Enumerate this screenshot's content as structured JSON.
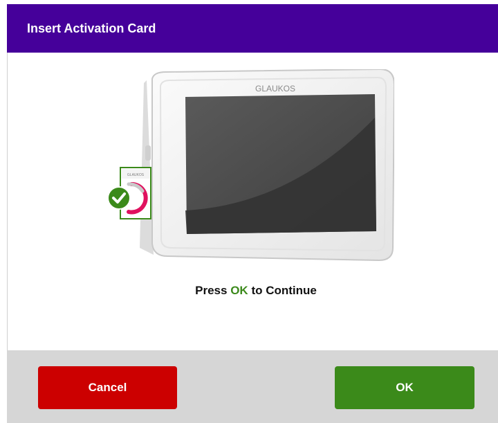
{
  "dialog": {
    "title": "Insert Activation Card",
    "message": {
      "prefix": "Press",
      "highlight": "OK",
      "suffix": "to Continue"
    }
  },
  "device": {
    "brand": "GLAUKOS",
    "card_brand": "GLAUKOS"
  },
  "buttons": {
    "cancel_label": "Cancel",
    "ok_label": "OK"
  },
  "colors": {
    "title_bar": "#45009a",
    "cancel": "#cc0000",
    "ok": "#3b8a1a",
    "ok_text": "#3c8a1c",
    "footer": "#d6d6d6"
  },
  "icons": {
    "card_status": "check-circle-icon"
  }
}
